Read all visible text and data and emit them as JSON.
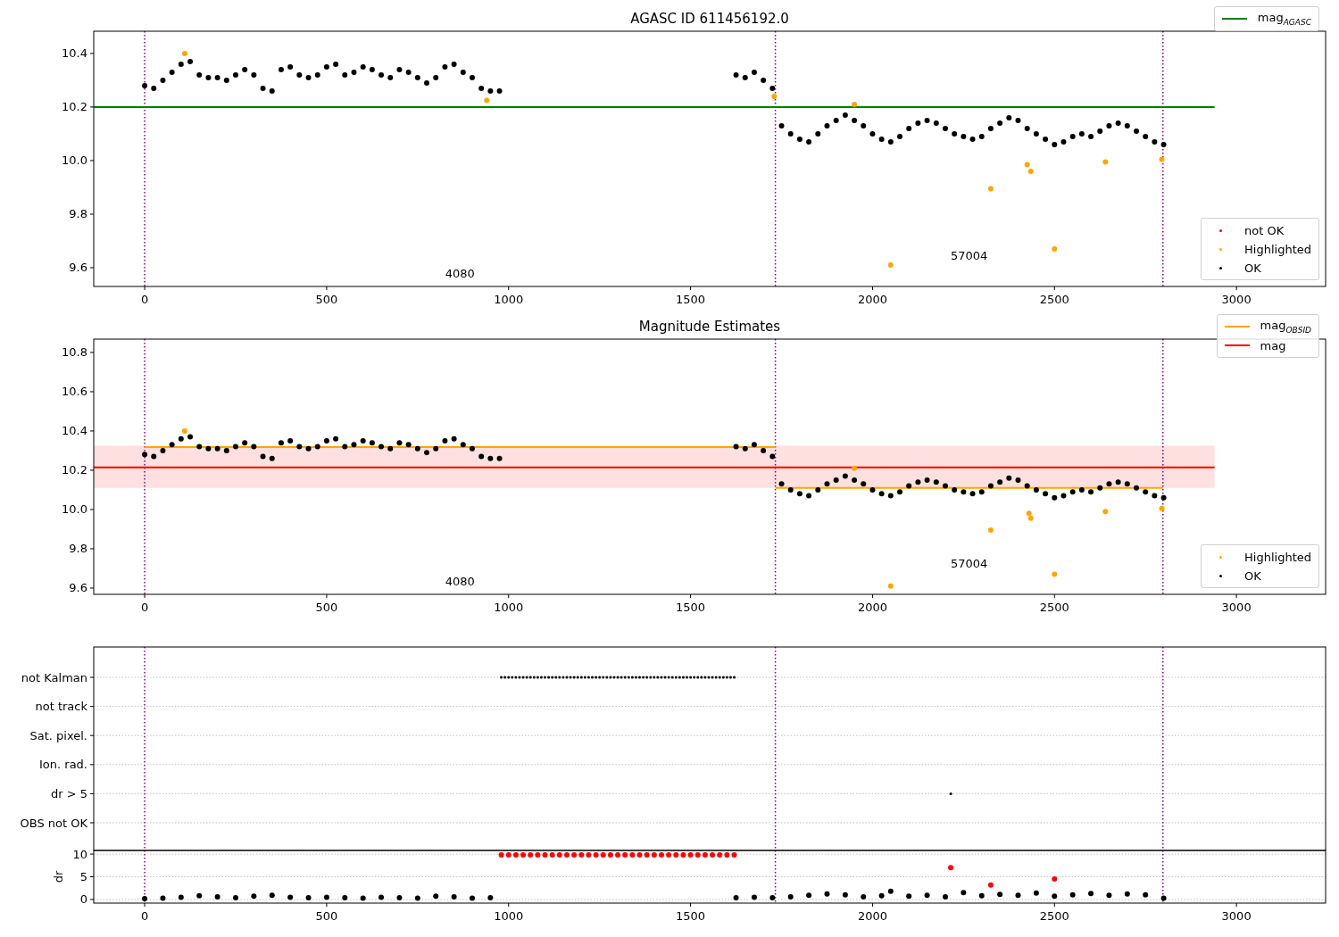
{
  "panels": [
    {
      "chart_data": {
        "type": "scatter",
        "title": "AGASC ID 611456192.0",
        "xlim": [
          -140,
          3245
        ],
        "ylim": [
          9.53,
          10.483
        ],
        "xticks": [
          0,
          500,
          1000,
          1500,
          2000,
          2500,
          3000
        ],
        "yticks": [
          9.6,
          9.8,
          {
            "value": 10,
            "label": "10.0"
          },
          10.2,
          10.4
        ],
        "series": [
          {
            "name": "mag$_{AGASC}$",
            "type": "line",
            "color": "#008000",
            "x": [
              -140,
              2940
            ],
            "values": [
              10.2,
              10.2
            ]
          },
          {
            "name": "not OK",
            "color": "#ff0000"
          },
          {
            "name": "Highlighted",
            "color": "#ffa500",
            "x": [
              110,
              940,
              1730,
              1950,
              2050,
              2325,
              2425,
              2435,
              2500,
              2640,
              2795
            ],
            "values": [
              10.4,
              10.225,
              10.24,
              10.21,
              9.61,
              9.895,
              9.985,
              9.96,
              9.67,
              9.995,
              10.005
            ]
          },
          {
            "name": "OK",
            "color": "#000000",
            "x": [
              0,
              25,
              50,
              75,
              100,
              125,
              150,
              175,
              200,
              225,
              250,
              275,
              300,
              325,
              350,
              375,
              400,
              425,
              450,
              475,
              500,
              525,
              550,
              575,
              600,
              625,
              650,
              675,
              700,
              725,
              750,
              775,
              800,
              825,
              850,
              875,
              900,
              925,
              950,
              975,
              1625,
              1650,
              1675,
              1700,
              1725,
              1750,
              1775,
              1800,
              1825,
              1850,
              1875,
              1900,
              1925,
              1950,
              1975,
              2000,
              2025,
              2050,
              2075,
              2100,
              2125,
              2150,
              2175,
              2200,
              2225,
              2250,
              2275,
              2300,
              2325,
              2350,
              2375,
              2400,
              2425,
              2450,
              2475,
              2500,
              2525,
              2550,
              2575,
              2600,
              2625,
              2650,
              2675,
              2700,
              2725,
              2750,
              2775,
              2800
            ],
            "values": [
              10.28,
              10.27,
              10.3,
              10.33,
              10.36,
              10.37,
              10.32,
              10.31,
              10.31,
              10.3,
              10.32,
              10.34,
              10.32,
              10.27,
              10.26,
              10.34,
              10.35,
              10.32,
              10.31,
              10.32,
              10.35,
              10.36,
              10.32,
              10.33,
              10.35,
              10.34,
              10.32,
              10.31,
              10.34,
              10.33,
              10.31,
              10.29,
              10.31,
              10.35,
              10.36,
              10.33,
              10.31,
              10.27,
              10.26,
              10.26,
              10.32,
              10.31,
              10.33,
              10.3,
              10.27,
              10.13,
              10.1,
              10.08,
              10.07,
              10.1,
              10.13,
              10.15,
              10.17,
              10.15,
              10.13,
              10.1,
              10.08,
              10.07,
              10.09,
              10.12,
              10.14,
              10.15,
              10.14,
              10.12,
              10.1,
              10.09,
              10.08,
              10.09,
              10.12,
              10.14,
              10.16,
              10.15,
              10.12,
              10.1,
              10.08,
              10.06,
              10.07,
              10.09,
              10.1,
              10.09,
              10.11,
              10.13,
              10.14,
              10.13,
              10.11,
              10.09,
              10.07,
              10.06
            ]
          }
        ],
        "ref_lines": [
          {
            "axis": "x",
            "value": 0,
            "color": "#800080"
          },
          {
            "axis": "x",
            "value": 1733,
            "color": "#800080"
          },
          {
            "axis": "x",
            "value": 2798,
            "color": "#800080"
          }
        ],
        "annotations": [
          "4080",
          "57004"
        ]
      }
    },
    {
      "chart_data": {
        "type": "scatter",
        "title": "Magnitude Estimates",
        "xlim": [
          -140,
          3245
        ],
        "ylim": [
          9.568,
          10.868
        ],
        "xticks": [
          0,
          500,
          1000,
          1500,
          2000,
          2500,
          3000
        ],
        "yticks": [
          9.6,
          9.8,
          {
            "value": 10,
            "label": "10.0"
          },
          10.2,
          10.4,
          10.6,
          10.8
        ],
        "series": [
          {
            "name": "mag$_{OBSID}$",
            "type": "line",
            "color": "#ffa500",
            "x": [
              0,
              1733,
              1733.5,
              1734,
              2798
            ],
            "values": [
              10.318,
              10.318,
              null,
              10.11,
              10.11
            ]
          },
          {
            "name": "mag",
            "type": "line",
            "color": "#ff0000",
            "x": [
              -140,
              2940
            ],
            "values": [
              10.215,
              10.215
            ]
          },
          {
            "name": "Highlighted",
            "color": "#ffa500",
            "x": [
              110,
              1950,
              2050,
              2325,
              2430,
              2435,
              2500,
              2640,
              2795
            ],
            "values": [
              10.4,
              10.21,
              9.61,
              9.895,
              9.98,
              9.955,
              9.67,
              9.99,
              10.005
            ]
          },
          {
            "name": "OK",
            "color": "#000000",
            "x": [
              0,
              25,
              50,
              75,
              100,
              125,
              150,
              175,
              200,
              225,
              250,
              275,
              300,
              325,
              350,
              375,
              400,
              425,
              450,
              475,
              500,
              525,
              550,
              575,
              600,
              625,
              650,
              675,
              700,
              725,
              750,
              775,
              800,
              825,
              850,
              875,
              900,
              925,
              950,
              975,
              1625,
              1650,
              1675,
              1700,
              1725,
              1750,
              1775,
              1800,
              1825,
              1850,
              1875,
              1900,
              1925,
              1950,
              1975,
              2000,
              2025,
              2050,
              2075,
              2100,
              2125,
              2150,
              2175,
              2200,
              2225,
              2250,
              2275,
              2300,
              2325,
              2350,
              2375,
              2400,
              2425,
              2450,
              2475,
              2500,
              2525,
              2550,
              2575,
              2600,
              2625,
              2650,
              2675,
              2700,
              2725,
              2750,
              2775,
              2800
            ],
            "values": [
              10.28,
              10.27,
              10.3,
              10.33,
              10.36,
              10.37,
              10.32,
              10.31,
              10.31,
              10.3,
              10.32,
              10.34,
              10.32,
              10.27,
              10.26,
              10.34,
              10.35,
              10.32,
              10.31,
              10.32,
              10.35,
              10.36,
              10.32,
              10.33,
              10.35,
              10.34,
              10.32,
              10.31,
              10.34,
              10.33,
              10.31,
              10.29,
              10.31,
              10.35,
              10.36,
              10.33,
              10.31,
              10.27,
              10.26,
              10.26,
              10.32,
              10.31,
              10.33,
              10.3,
              10.27,
              10.13,
              10.1,
              10.08,
              10.07,
              10.1,
              10.13,
              10.15,
              10.17,
              10.15,
              10.13,
              10.1,
              10.08,
              10.07,
              10.09,
              10.12,
              10.14,
              10.15,
              10.14,
              10.12,
              10.1,
              10.09,
              10.08,
              10.09,
              10.12,
              10.14,
              10.16,
              10.15,
              10.12,
              10.1,
              10.08,
              10.06,
              10.07,
              10.09,
              10.1,
              10.09,
              10.11,
              10.13,
              10.14,
              10.13,
              10.11,
              10.09,
              10.07,
              10.06
            ]
          }
        ],
        "bands": [
          {
            "axis": "y",
            "from": 10.11,
            "to": 10.325,
            "color": "#ff0000"
          }
        ],
        "ref_lines": [
          {
            "axis": "x",
            "value": 0,
            "color": "#800080"
          },
          {
            "axis": "x",
            "value": 1733,
            "color": "#800080"
          },
          {
            "axis": "x",
            "value": 2798,
            "color": "#800080"
          }
        ],
        "annotations": [
          "4080",
          "57004"
        ]
      }
    },
    {
      "flags": {
        "row_labels": [
          "not Kalman",
          "not track",
          "Sat. pixel.",
          "Ion. rad.",
          "dr > 5",
          "OBS not OK"
        ]
      },
      "dr": {
        "chart_data": {
          "type": "scatter",
          "ylabel": "dr",
          "grid": true,
          "xlim": [
            -140,
            3245
          ],
          "ylim": [
            -0.8,
            10.8
          ],
          "xticks": [
            0,
            500,
            1000,
            1500,
            2000,
            2500,
            3000
          ],
          "yticks": [
            0,
            5,
            10
          ],
          "series": [
            {
              "color": "#ff0000",
              "x": [
                980,
                1000,
                1020,
                1040,
                1060,
                1080,
                1100,
                1120,
                1140,
                1160,
                1180,
                1200,
                1220,
                1240,
                1260,
                1280,
                1300,
                1320,
                1340,
                1360,
                1380,
                1400,
                1420,
                1440,
                1460,
                1480,
                1500,
                1520,
                1540,
                1560,
                1580,
                1600,
                1620,
                2215,
                2325,
                2500
              ],
              "values": [
                9.8,
                9.8,
                9.8,
                9.8,
                9.8,
                9.8,
                9.8,
                9.8,
                9.8,
                9.8,
                9.8,
                9.8,
                9.8,
                9.8,
                9.8,
                9.8,
                9.8,
                9.8,
                9.8,
                9.8,
                9.8,
                9.8,
                9.8,
                9.8,
                9.8,
                9.8,
                9.8,
                9.8,
                9.8,
                9.8,
                9.8,
                9.8,
                9.8,
                7,
                3.2,
                4.5
              ]
            },
            {
              "color": "#000000",
              "x": [
                0,
                50,
                100,
                150,
                200,
                250,
                300,
                350,
                400,
                450,
                500,
                550,
                600,
                650,
                700,
                750,
                800,
                850,
                900,
                950,
                1625,
                1675,
                1725,
                1775,
                1825,
                1875,
                1925,
                1975,
                2025,
                2050,
                2100,
                2150,
                2200,
                2250,
                2300,
                2350,
                2400,
                2450,
                2500,
                2550,
                2600,
                2650,
                2700,
                2750,
                2800
              ],
              "values": [
                0.2,
                0.3,
                0.5,
                0.8,
                0.6,
                0.4,
                0.7,
                0.9,
                0.5,
                0.4,
                0.5,
                0.4,
                0.3,
                0.5,
                0.4,
                0.3,
                0.7,
                0.6,
                0.3,
                0.4,
                0.4,
                0.5,
                0.4,
                0.6,
                0.9,
                1.2,
                1,
                0.6,
                0.8,
                1.8,
                0.7,
                0.9,
                0.6,
                1.5,
                0.8,
                1.1,
                0.9,
                1.4,
                0.7,
                1,
                1.3,
                0.9,
                1.2,
                1,
                0.3
              ]
            }
          ],
          "ref_lines": [
            {
              "axis": "x",
              "value": 0,
              "color": "#800080"
            },
            {
              "axis": "x",
              "value": 1733,
              "color": "#800080"
            },
            {
              "axis": "x",
              "value": 2798,
              "color": "#800080"
            }
          ]
        }
      }
    }
  ]
}
